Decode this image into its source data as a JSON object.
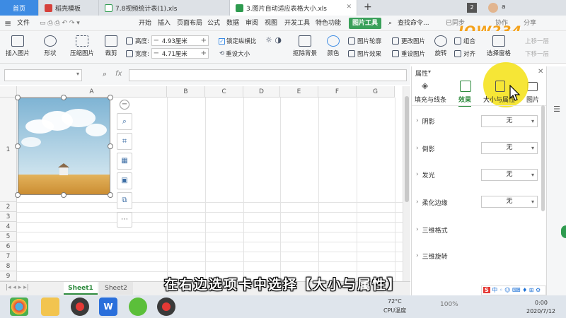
{
  "tabs": [
    {
      "label": "首页",
      "type": "home"
    },
    {
      "label": "稻壳模板",
      "icon_color": "#d6413b"
    },
    {
      "label": "7.8视频统计表(1).xls",
      "icon_color": "#2e9b4f"
    },
    {
      "label": "3.图片自动适应表格大小.xls",
      "icon_color": "#2e9b4f"
    }
  ],
  "tab_add": "+",
  "tab_count": "2",
  "user_initial": "a",
  "menu": {
    "file": "文件",
    "items": [
      "开始",
      "插入",
      "页面布局",
      "公式",
      "数据",
      "审阅",
      "视图",
      "开发工具",
      "特色功能"
    ],
    "picture_tools": "图片工具",
    "search": "查找命令...",
    "sync": "已同步",
    "collab": "协作",
    "share": "分享"
  },
  "ribbon": {
    "insert_picture": "插入图片",
    "shape": "形状",
    "compress": "压缩图片",
    "crop": "裁剪",
    "height_label": "高度:",
    "height_value": "4.93厘米",
    "width_label": "宽度:",
    "width_value": "4.71厘米",
    "lock_ratio": "锁定纵横比",
    "reset_size": "重设大小",
    "remove_bg": "抠除背景",
    "color": "颜色",
    "outline": "图片轮廓",
    "effects": "图片效果",
    "change": "更改图片",
    "reset_picture": "重设图片",
    "rotate": "旋转",
    "combine": "组合",
    "align": "对齐",
    "select_pane": "选择窗格",
    "bring_up": "上移一层",
    "send_down": "下移一层",
    "minus": "−",
    "plus": "+"
  },
  "formula_bar": {
    "fx": "fx",
    "zoom_icon": "zoom-icon"
  },
  "columns": [
    "A",
    "B",
    "C",
    "D",
    "E",
    "F",
    "G"
  ],
  "rows": [
    "1",
    "2",
    "3",
    "4",
    "5",
    "6",
    "7",
    "8",
    "9"
  ],
  "sheets": [
    "Sheet1",
    "Sheet2"
  ],
  "float_tools": [
    "−",
    "⋯"
  ],
  "panel": {
    "title": "属性",
    "tabs": [
      "填充与线条",
      "效果",
      "大小与属性",
      "图片"
    ],
    "active_tab": 1,
    "rows": [
      {
        "label": "阴影",
        "value": "无"
      },
      {
        "label": "倒影",
        "value": "无"
      },
      {
        "label": "发光",
        "value": "无"
      },
      {
        "label": "柔化边缘",
        "value": "无"
      },
      {
        "label": "三维格式",
        "value": ""
      },
      {
        "label": "三维旋转",
        "value": ""
      }
    ]
  },
  "subtitle": "在右边选项卡中选择【大小与属性】",
  "watermark": "JOW234",
  "status": {
    "zoom": "100%",
    "cpu_temp": "72°C",
    "cpu_label": "CPU温度",
    "date": "2020/7/12",
    "time": "0:00"
  },
  "colors": {
    "accent": "#3d8be3",
    "tool_green": "#3aa05a",
    "highlight": "#f5e21a",
    "watermark_orange": "#f4a21c"
  }
}
